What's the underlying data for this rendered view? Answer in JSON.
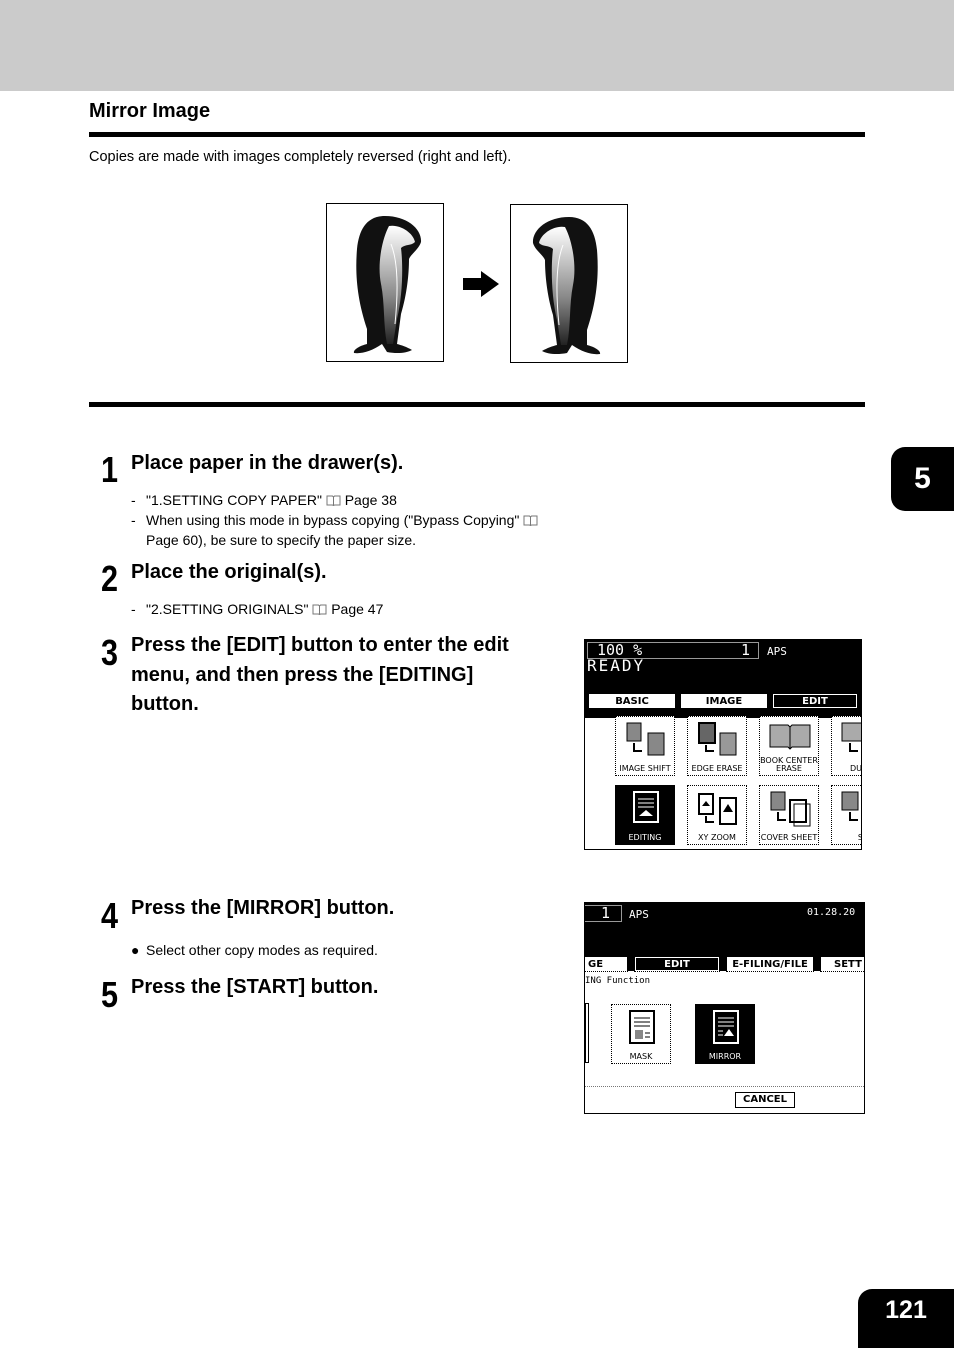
{
  "section": {
    "title": "Mirror Image",
    "description": "Copies are made with images completely reversed (right and left)."
  },
  "steps": [
    {
      "number": "1",
      "title": "Place paper in the drawer(s).",
      "notes": [
        {
          "bullet": "-",
          "text_before": "\"1.SETTING COPY PAPER\"",
          "icon": "book-icon",
          "text_after": "Page 38"
        },
        {
          "bullet": "-",
          "text_before": "When using this mode in bypass copying (\"Bypass Copying\"",
          "icon": "book-icon",
          "text_after": "",
          "continuation": "Page 60), be sure to specify the paper size."
        }
      ]
    },
    {
      "number": "2",
      "title": "Place the original(s).",
      "notes": [
        {
          "bullet": "-",
          "text_before": "\"2.SETTING ORIGINALS\"",
          "icon": "book-icon",
          "text_after": "Page 47"
        }
      ]
    },
    {
      "number": "3",
      "title_lines": [
        "Press the [EDIT] button to enter the edit",
        "menu, and then press the [EDITING]",
        "button."
      ]
    },
    {
      "number": "4",
      "title": "Press the [MIRROR] button.",
      "notes": [
        {
          "bullet": "●",
          "text": "Select other copy modes as required."
        }
      ]
    },
    {
      "number": "5",
      "title": "Press the [START] button."
    }
  ],
  "screen1": {
    "zoom": "100  %",
    "copies": "1",
    "paper": "APS",
    "status": "READY",
    "tabs": [
      {
        "label": "BASIC",
        "selected": false
      },
      {
        "label": "IMAGE",
        "selected": false
      },
      {
        "label": "EDIT",
        "selected": true
      }
    ],
    "functions": [
      {
        "label": "IMAGE SHIFT",
        "selected": false
      },
      {
        "label": "EDGE ERASE",
        "selected": false
      },
      {
        "label": "BOOK CENTER ERASE",
        "selected": false
      },
      {
        "label": "DUAL",
        "selected": false
      },
      {
        "label": "EDITING",
        "selected": true
      },
      {
        "label": "XY ZOOM",
        "selected": false
      },
      {
        "label": "COVER SHEET",
        "selected": false
      },
      {
        "label": "SH INSE",
        "selected": false
      }
    ]
  },
  "screen2": {
    "copies": "1",
    "paper": "APS",
    "date": "01.28.20",
    "tabs": [
      {
        "label": "GE",
        "selected": false
      },
      {
        "label": "EDIT",
        "selected": true
      },
      {
        "label": "E-FILING/FILE",
        "selected": false
      },
      {
        "label": "SETT",
        "selected": false
      }
    ],
    "heading": "ING Function",
    "functions": [
      {
        "label": "MASK",
        "selected": false
      },
      {
        "label": "MIRROR",
        "selected": true
      }
    ],
    "cancel_label": "CANCEL"
  },
  "chapter_tab": "5",
  "page_number": "121"
}
